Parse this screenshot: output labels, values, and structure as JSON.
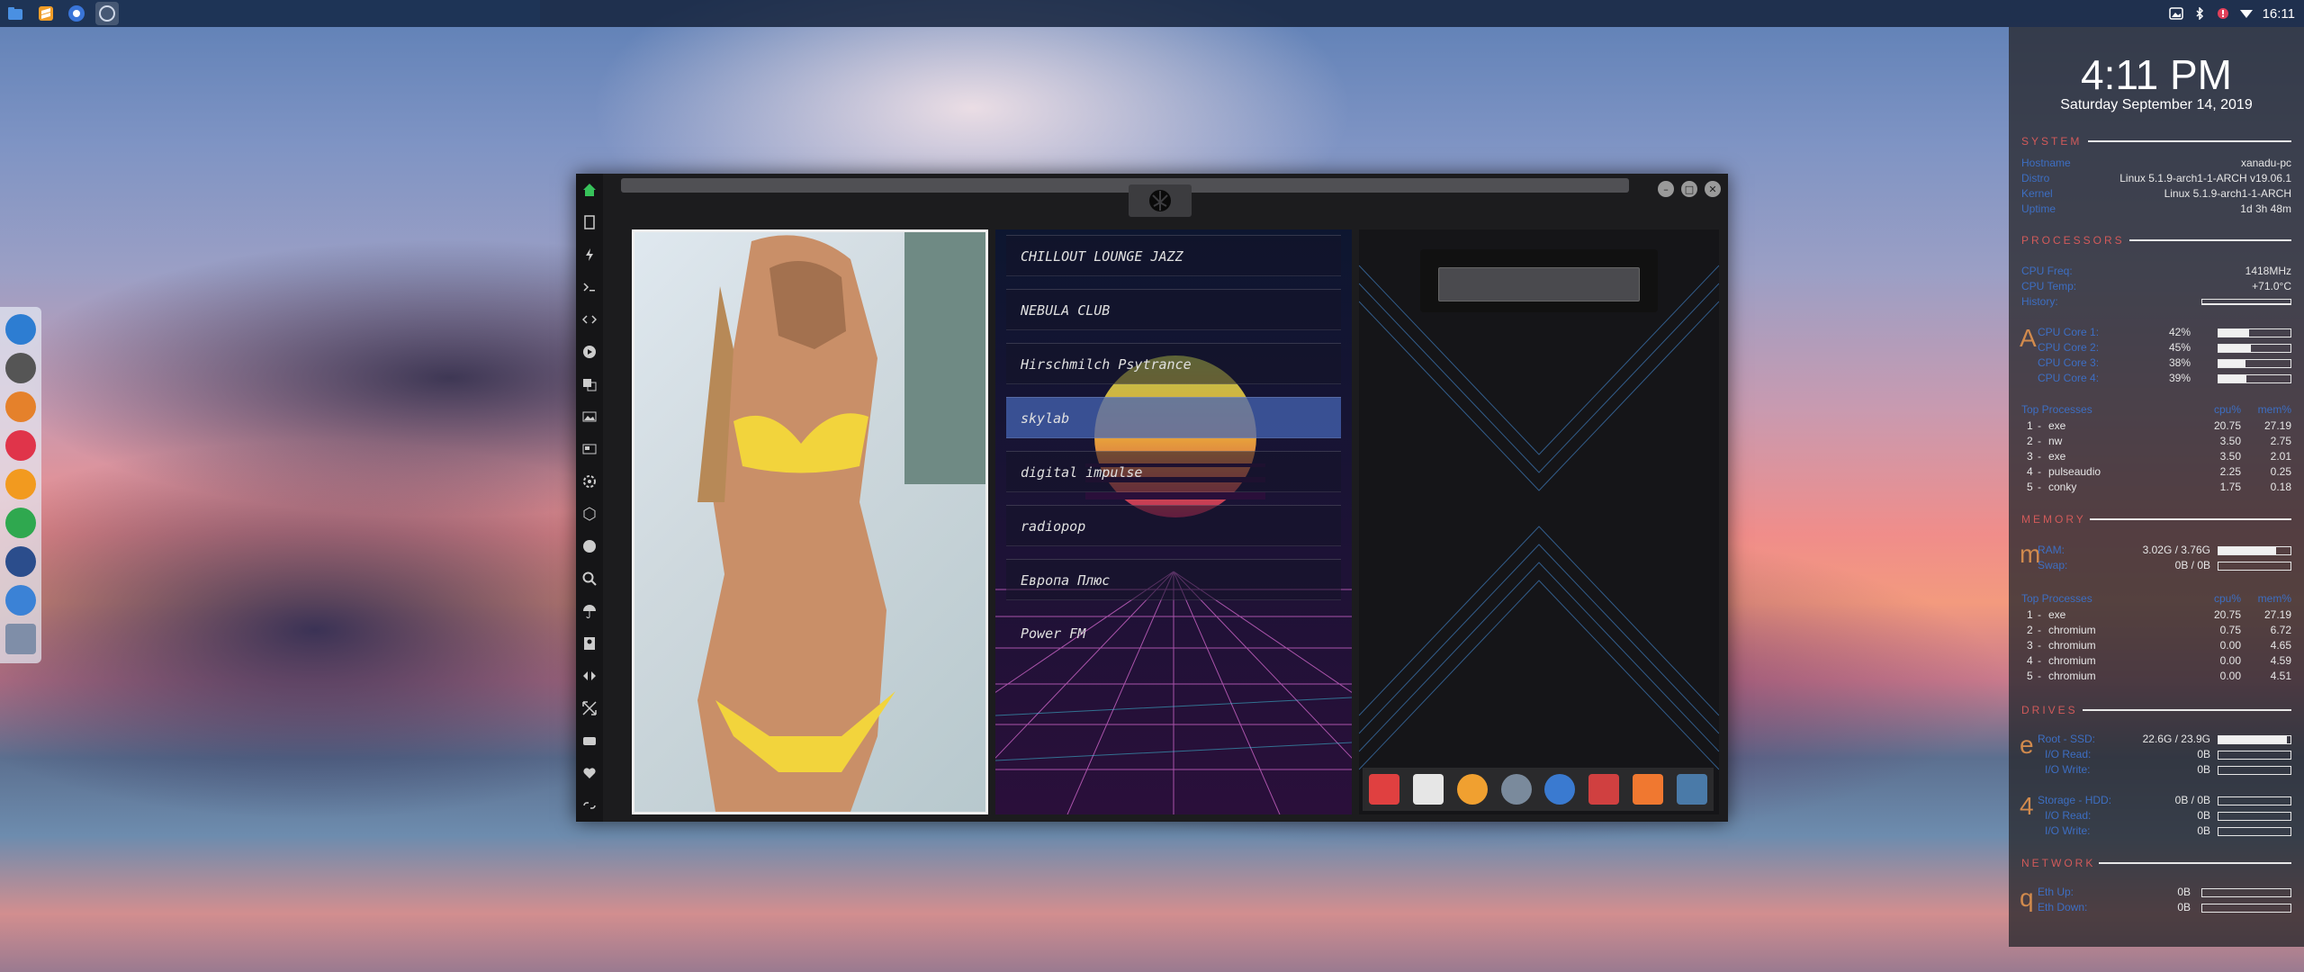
{
  "top_panel": {
    "tasks": [
      "file-manager-icon",
      "sublime-icon",
      "chrome-icon",
      "app-grid-icon"
    ],
    "tray_icons": [
      "image-icon",
      "bluetooth-icon",
      "alert-icon",
      "wifi-icon"
    ],
    "clock": "16:11"
  },
  "left_dock": {
    "items": [
      "files-icon",
      "terminal-icon",
      "ubuntu-icon",
      "vivaldi-icon",
      "sublime-icon",
      "activity-icon",
      "screenshot-icon",
      "chrome-icon",
      "app-grid-icon"
    ]
  },
  "conky": {
    "time": "4:11 PM",
    "date": "Saturday September 14, 2019",
    "system": {
      "title": "SYSTEM",
      "rows": [
        {
          "label": "Hostname",
          "value": "xanadu-pc"
        },
        {
          "label": "Distro",
          "value": "Linux 5.1.9-arch1-1-ARCH v19.06.1"
        },
        {
          "label": "Kernel",
          "value": "Linux 5.1.9-arch1-1-ARCH"
        },
        {
          "label": "Uptime",
          "value": "1d 3h 48m"
        }
      ]
    },
    "processors": {
      "title": "PROCESSORS",
      "freq_label": "CPU Freq:",
      "freq": "1418MHz",
      "temp_label": "CPU Temp:",
      "temp": "+71.0°C",
      "history_label": "History:",
      "big": "A",
      "cores": [
        {
          "label": "CPU Core 1:",
          "value": "42%",
          "level": 0.42
        },
        {
          "label": "CPU Core 2:",
          "value": "45%",
          "level": 0.45
        },
        {
          "label": "CPU Core 3:",
          "value": "38%",
          "level": 0.38
        },
        {
          "label": "CPU Core 4:",
          "value": "39%",
          "level": 0.39
        }
      ],
      "top_label": "Top Processes",
      "cpu_header": "cpu%",
      "mem_header": "mem%",
      "top": [
        {
          "rank": "1",
          "name": "exe",
          "cpu": "20.75",
          "mem": "27.19"
        },
        {
          "rank": "2",
          "name": "nw",
          "cpu": "3.50",
          "mem": "2.75"
        },
        {
          "rank": "3",
          "name": "exe",
          "cpu": "3.50",
          "mem": "2.01"
        },
        {
          "rank": "4",
          "name": "pulseaudio",
          "cpu": "2.25",
          "mem": "0.25"
        },
        {
          "rank": "5",
          "name": "conky",
          "cpu": "1.75",
          "mem": "0.18"
        }
      ]
    },
    "memory": {
      "title": "MEMORY",
      "big": "m",
      "ram_label": "RAM:",
      "ram": "3.02G / 3.76G",
      "ram_level": 0.8,
      "swap_label": "Swap:",
      "swap": "0B / 0B",
      "swap_level": 0,
      "top_label": "Top Processes",
      "cpu_header": "cpu%",
      "mem_header": "mem%",
      "top": [
        {
          "rank": "1",
          "name": "exe",
          "cpu": "20.75",
          "mem": "27.19"
        },
        {
          "rank": "2",
          "name": "chromium",
          "cpu": "0.75",
          "mem": "6.72"
        },
        {
          "rank": "3",
          "name": "chromium",
          "cpu": "0.00",
          "mem": "4.65"
        },
        {
          "rank": "4",
          "name": "chromium",
          "cpu": "0.00",
          "mem": "4.59"
        },
        {
          "rank": "5",
          "name": "chromium",
          "cpu": "0.00",
          "mem": "4.51"
        }
      ]
    },
    "drives": {
      "title": "DRIVES",
      "big1": "e",
      "root_label": "Root - SSD:",
      "root": "22.6G / 23.9G",
      "root_level": 0.95,
      "io_read_label": "I/O Read:",
      "io_read": "0B",
      "io_write_label": "I/O Write:",
      "io_write": "0B",
      "big2": "4",
      "storage_label": "Storage - HDD:",
      "storage": "0B / 0B",
      "s_read_label": "I/O Read:",
      "s_read": "0B",
      "s_write_label": "I/O Write:",
      "s_write": "0B"
    },
    "network": {
      "title": "NETWORK",
      "big": "q",
      "up_label": "Eth Up:",
      "up": "0B",
      "down_label": "Eth Down:",
      "down": "0B"
    }
  },
  "window": {
    "sidebar_icons": [
      "home-icon",
      "document-icon",
      "bolt-icon",
      "terminal-icon",
      "code-icon",
      "play-icon",
      "translate-icon",
      "image-icon",
      "news-icon",
      "settings-icon",
      "hexagon-icon",
      "globe-icon",
      "search-icon",
      "umbrella-icon",
      "contact-icon",
      "share-icon",
      "expand-icon",
      "youtube-icon",
      "heart-icon",
      "link-icon"
    ],
    "stations": [
      "CHILLOUT LOUNGE JAZZ",
      "NEBULA CLUB",
      "Hirschmilch Psytrance",
      "skylab",
      "digital impulse",
      "radiopop",
      "Европа Плюс",
      "Power FM"
    ],
    "active_station": 3,
    "launcher_icons": [
      "arrow-app-icon",
      "news-app-icon",
      "search-app-icon",
      "clock-app-icon",
      "globe-app-icon",
      "calendar-app-icon",
      "forward-app-icon",
      "calculator-app-icon"
    ]
  },
  "colors": {
    "accent_red": "#d15a5a",
    "label_blue": "#3d6ec2",
    "active_station": "#4664b4"
  }
}
